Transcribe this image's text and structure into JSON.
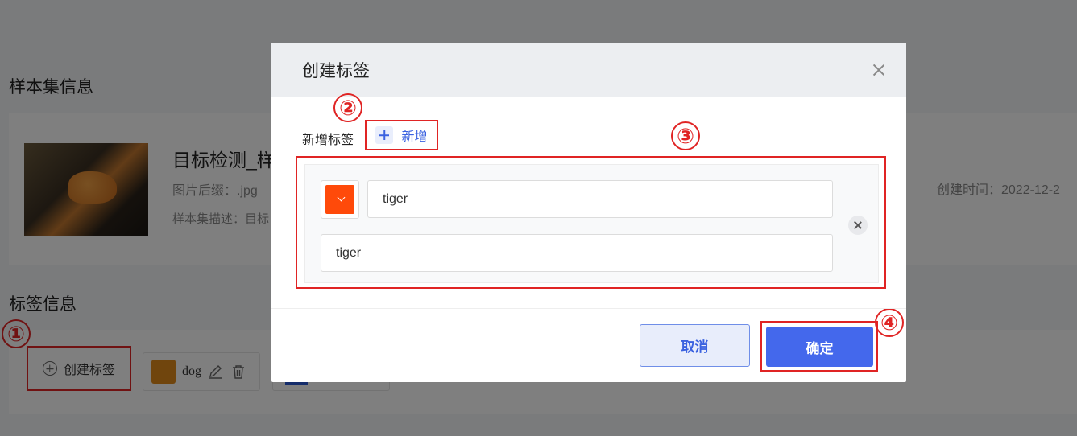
{
  "background": {
    "dataset_section_title": "样本集信息",
    "dataset_name": "目标检测_样",
    "image_suffix": "图片后缀：.jpg",
    "dataset_desc": "样本集描述：目标",
    "created_time": "创建时间：2022-12-2",
    "label_section_title": "标签信息",
    "create_label_button": "创建标签",
    "existing_labels": [
      {
        "name": "dog",
        "color": "#e08a1a"
      }
    ]
  },
  "modal": {
    "title": "创建标签",
    "add_label_text": "新增标签",
    "add_button": "新增",
    "rows": [
      {
        "color": "#ff4a0a",
        "value": "tiger",
        "alias": "tiger"
      }
    ],
    "cancel_button": "取消",
    "ok_button": "确定"
  },
  "annotations": {
    "step1": "①",
    "step2": "②",
    "step3": "③",
    "step4": "④",
    "highlight_color": "#e02424"
  }
}
